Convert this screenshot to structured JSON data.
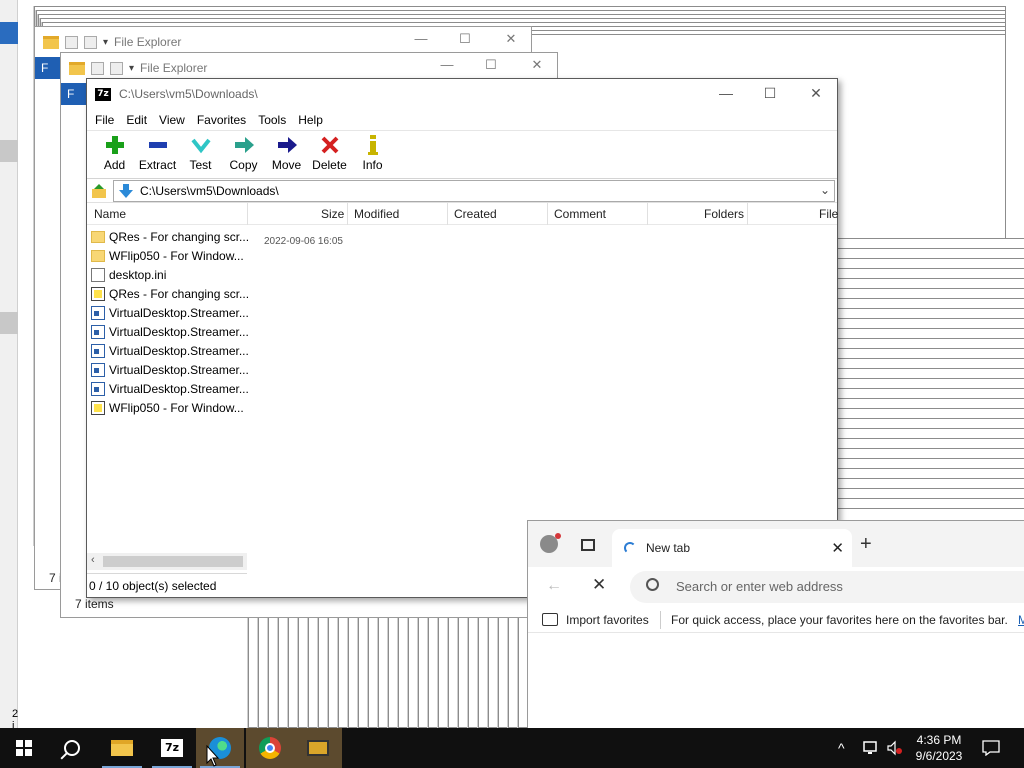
{
  "desktop": {
    "left_status": "2 i"
  },
  "explorer_back": {
    "title": "File Explorer",
    "status": "7 i",
    "ribbon_letter": "F"
  },
  "explorer_front": {
    "title": "File Explorer",
    "status": "7 items",
    "ribbon_letter": "F"
  },
  "sevenzip": {
    "title": "C:\\Users\\vm5\\Downloads\\",
    "menu": [
      "File",
      "Edit",
      "View",
      "Favorites",
      "Tools",
      "Help"
    ],
    "toolbar": [
      {
        "label": "Add",
        "icon": "add-icon"
      },
      {
        "label": "Extract",
        "icon": "extract-icon"
      },
      {
        "label": "Test",
        "icon": "test-icon"
      },
      {
        "label": "Copy",
        "icon": "copy-icon"
      },
      {
        "label": "Move",
        "icon": "move-icon"
      },
      {
        "label": "Delete",
        "icon": "delete-icon"
      },
      {
        "label": "Info",
        "icon": "info-icon"
      }
    ],
    "address": "C:\\Users\\vm5\\Downloads\\",
    "columns": [
      "Name",
      "Size",
      "Modified",
      "Created",
      "Comment",
      "Folders",
      "File"
    ],
    "smear_text": "2022-09-06 16:05   2022-09-06 16:05",
    "files": [
      {
        "name": "QRes - For changing scr...",
        "type": "folder"
      },
      {
        "name": "WFlip050 - For Window...",
        "type": "folder"
      },
      {
        "name": "desktop.ini",
        "type": "ini"
      },
      {
        "name": "QRes - For changing scr...",
        "type": "archive"
      },
      {
        "name": "VirtualDesktop.Streamer...",
        "type": "app"
      },
      {
        "name": "VirtualDesktop.Streamer...",
        "type": "app"
      },
      {
        "name": "VirtualDesktop.Streamer...",
        "type": "app"
      },
      {
        "name": "VirtualDesktop.Streamer...",
        "type": "app"
      },
      {
        "name": "VirtualDesktop.Streamer...",
        "type": "app"
      },
      {
        "name": "WFlip050 - For Window...",
        "type": "archive"
      }
    ],
    "status": "0 / 10 object(s) selected"
  },
  "edge": {
    "tab_title": "New tab",
    "search_placeholder": "Search or enter web address",
    "import_label": "Import favorites",
    "favorites_hint": "For quick access, place your favorites here on the favorites bar.",
    "more_link": "M"
  },
  "taskbar": {
    "time": "4:36 PM",
    "date": "9/6/2023",
    "apps": [
      "start",
      "search",
      "file-explorer",
      "7-zip",
      "edge",
      "chrome",
      "screen-app"
    ]
  },
  "colors": {
    "taskbar": "#101010",
    "accent": "#1f5fb3"
  }
}
